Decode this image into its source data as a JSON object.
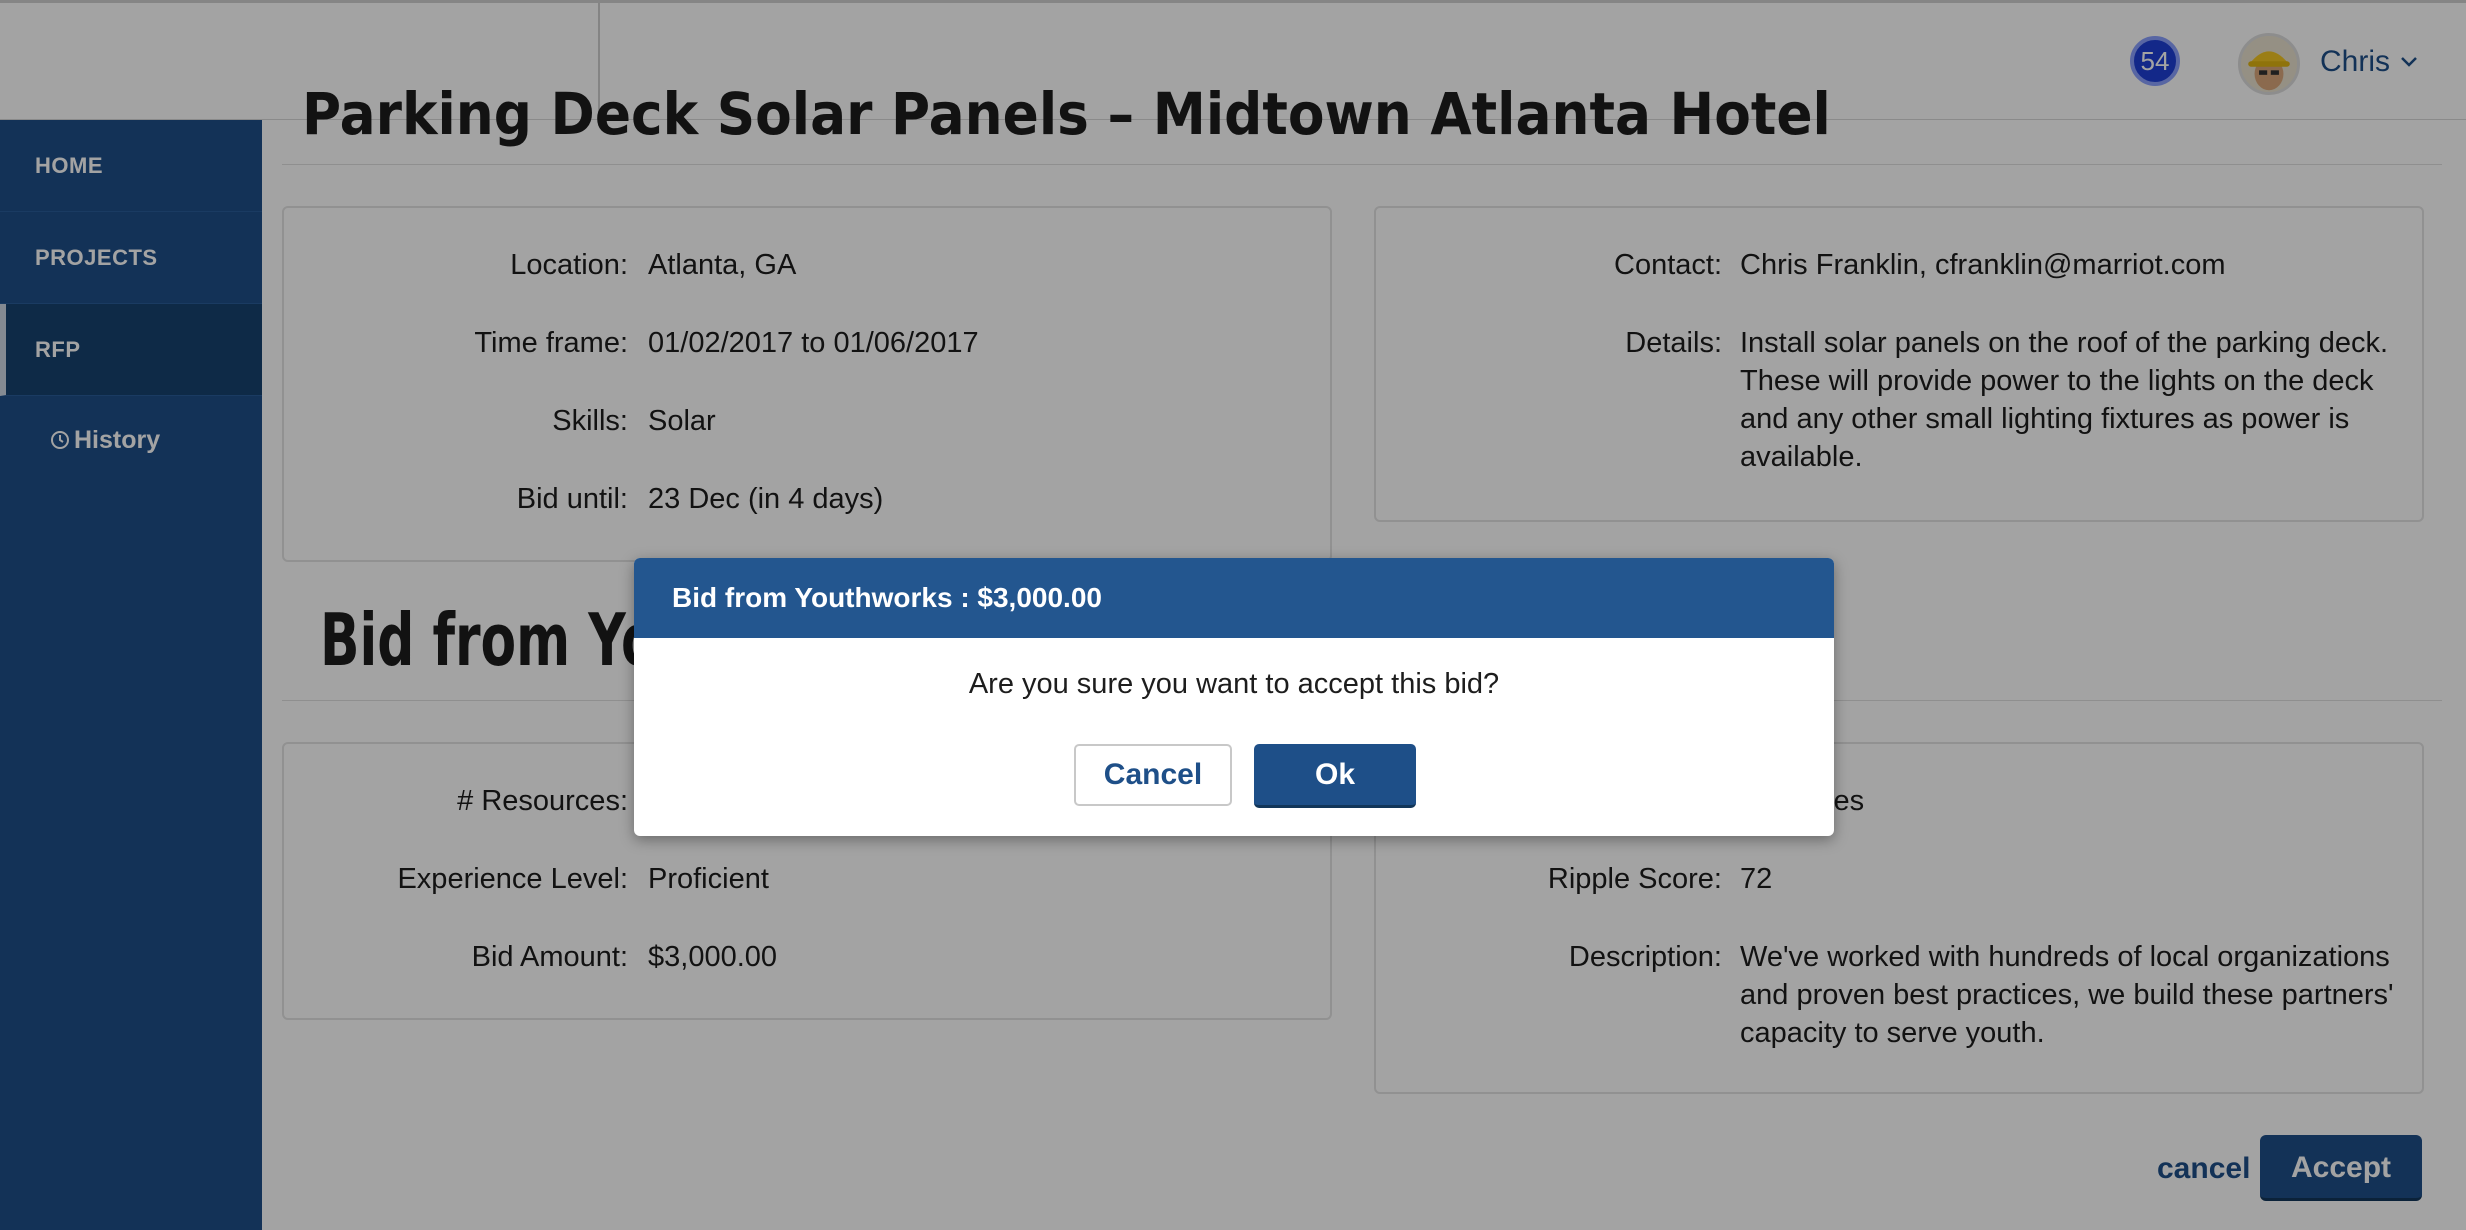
{
  "header": {
    "notification_count": "54",
    "user_name": "Chris"
  },
  "sidebar": {
    "items": [
      {
        "label": "HOME"
      },
      {
        "label": "PROJECTS"
      },
      {
        "label": "RFP"
      }
    ],
    "sub_item": {
      "label": "History"
    }
  },
  "project": {
    "title": "Parking Deck Solar Panels – Midtown Atlanta Hotel",
    "left_fields": [
      {
        "label": "Location:",
        "value": "Atlanta, GA"
      },
      {
        "label": "Time frame:",
        "value": "01/02/2017 to 01/06/2017"
      },
      {
        "label": "Skills:",
        "value": "Solar"
      },
      {
        "label": "Bid until:",
        "value": "23 Dec (in 4 days)"
      }
    ],
    "right_fields": [
      {
        "label": "Contact:",
        "value": "Chris Franklin, cfranklin@marriot.com"
      },
      {
        "label": "Details:",
        "value": "Install solar panels on the roof of the parking deck. These will provide power to the lights on the deck and any other small lighting fixtures as power is available."
      }
    ]
  },
  "bid": {
    "heading": "Bid from Youthworks",
    "left_fields": [
      {
        "label": "# Resources:",
        "value": ""
      },
      {
        "label": "Experience Level:",
        "value": "Proficient"
      },
      {
        "label": "Bid Amount:",
        "value": "$3,000.00"
      }
    ],
    "right_fields": [
      {
        "label": "",
        "value": "e Charles"
      },
      {
        "label": "Ripple Score:",
        "value": "72"
      },
      {
        "label": "Description:",
        "value": "We've worked with hundreds of local organizations and proven best practices, we build these partners' capacity to serve youth."
      }
    ],
    "cancel_label": "cancel",
    "accept_label": "Accept"
  },
  "modal": {
    "title": "Bid from Youthworks : $3,000.00",
    "message": "Are you sure you want to accept this bid?",
    "cancel_label": "Cancel",
    "ok_label": "Ok"
  },
  "colors": {
    "brand": "#1e4f88",
    "modal_header": "#23568f",
    "badge": "#1f3fd6"
  }
}
